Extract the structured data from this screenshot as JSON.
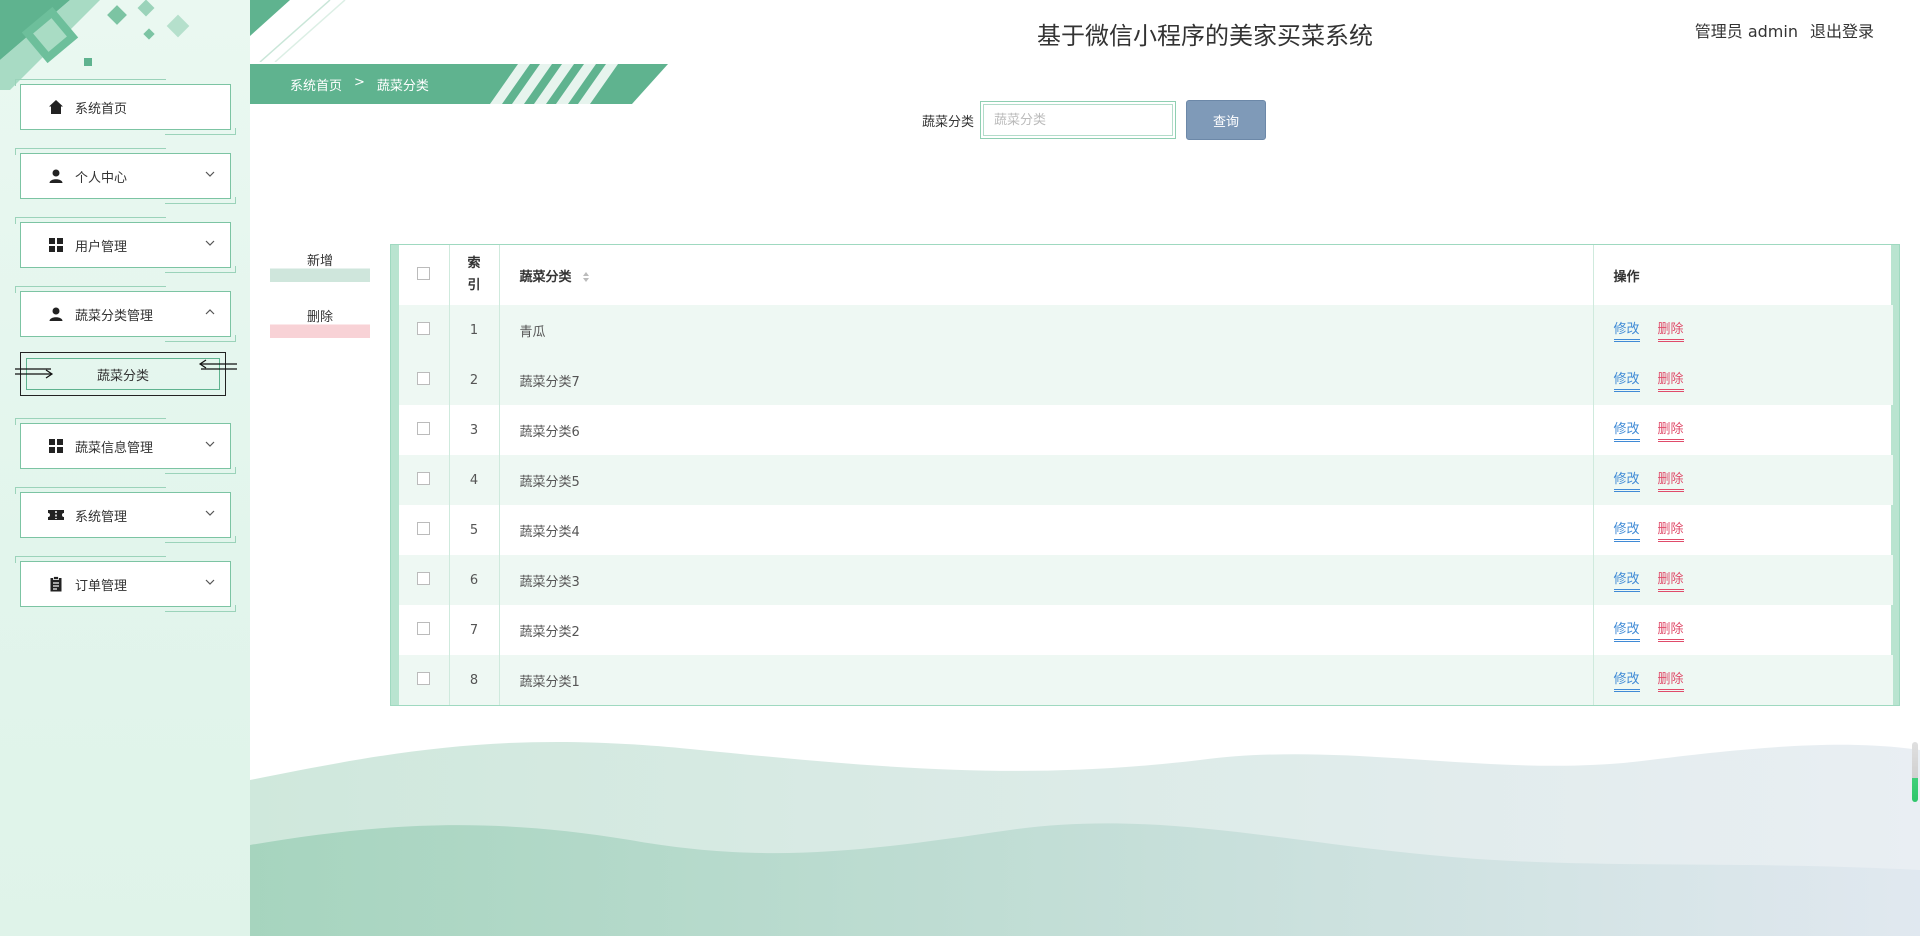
{
  "header": {
    "title": "基于微信小程序的美家买菜系统",
    "user_label": "管理员 admin",
    "logout_label": "退出登录"
  },
  "breadcrumb": {
    "home": "系统首页",
    "separator": ">",
    "current": "蔬菜分类"
  },
  "sidebar": {
    "items": [
      {
        "label": "系统首页",
        "icon": "home-icon"
      },
      {
        "label": "个人中心",
        "icon": "person-icon"
      },
      {
        "label": "用户管理",
        "icon": "grid-icon"
      },
      {
        "label": "蔬菜分类管理",
        "icon": "person-icon",
        "expanded": true
      },
      {
        "label": "蔬菜分类",
        "sub": true
      },
      {
        "label": "蔬菜信息管理",
        "icon": "grid-icon"
      },
      {
        "label": "系统管理",
        "icon": "ticket-icon"
      },
      {
        "label": "订单管理",
        "icon": "clipboard-icon"
      }
    ]
  },
  "search": {
    "label": "蔬菜分类",
    "placeholder": "蔬菜分类",
    "button_label": "查询"
  },
  "actions": {
    "add_label": "新增",
    "delete_label": "删除"
  },
  "table": {
    "headers": {
      "index": "索引",
      "name": "蔬菜分类",
      "operation": "操作"
    },
    "rows": [
      {
        "index": "1",
        "name": "青瓜"
      },
      {
        "index": "2",
        "name": "蔬菜分类7"
      },
      {
        "index": "3",
        "name": "蔬菜分类6"
      },
      {
        "index": "4",
        "name": "蔬菜分类5"
      },
      {
        "index": "5",
        "name": "蔬菜分类4"
      },
      {
        "index": "6",
        "name": "蔬菜分类3"
      },
      {
        "index": "7",
        "name": "蔬菜分类2"
      },
      {
        "index": "8",
        "name": "蔬菜分类1"
      }
    ],
    "edit_label": "修改",
    "delete_label": "删除"
  },
  "colors": {
    "accent": "#5fb38f",
    "search_button": "#7f9ab8",
    "edit_link": "#3f8ad6",
    "delete_link": "#e04b6a"
  }
}
